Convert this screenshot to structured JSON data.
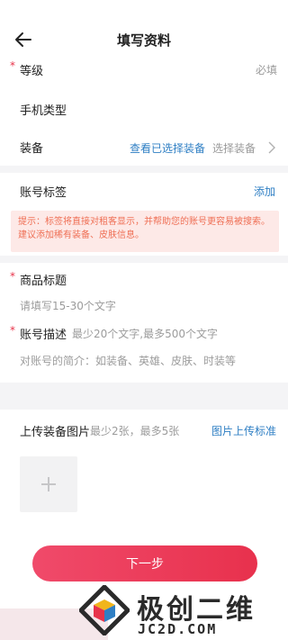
{
  "header": {
    "title": "填写资料"
  },
  "form": {
    "level": {
      "label": "等级",
      "required_hint": "必填"
    },
    "phone_type": {
      "label": "手机类型"
    },
    "equipment": {
      "label": "装备",
      "view_link": "查看已选择装备",
      "select_label": "选择装备"
    },
    "account_tags": {
      "label": "账号标签",
      "add_link": "添加"
    },
    "tip": "提示：标签将直接对租客显示，并帮助您的账号更容易被搜索。建议添加稀有装备、皮肤信息。",
    "product_title": {
      "label": "商品标题",
      "placeholder": "请填写15-30个文字"
    },
    "account_desc": {
      "label": "账号描述",
      "hint": "最少20个文字,最多500个文字",
      "placeholder": "对账号的简介：如装备、英雄、皮肤、时装等"
    },
    "upload": {
      "label": "上传装备图片",
      "hint": "最少2张，最多5张",
      "standard_link": "图片上传标准"
    }
  },
  "next_button": "下一步",
  "watermark": {
    "brand": "极创二维",
    "domain": "JC2D.COM"
  },
  "colors": {
    "accent": "#e8334a",
    "link": "#2f7fc4",
    "tip_bg": "#fde9e7",
    "tip_text": "#ef6f55"
  }
}
